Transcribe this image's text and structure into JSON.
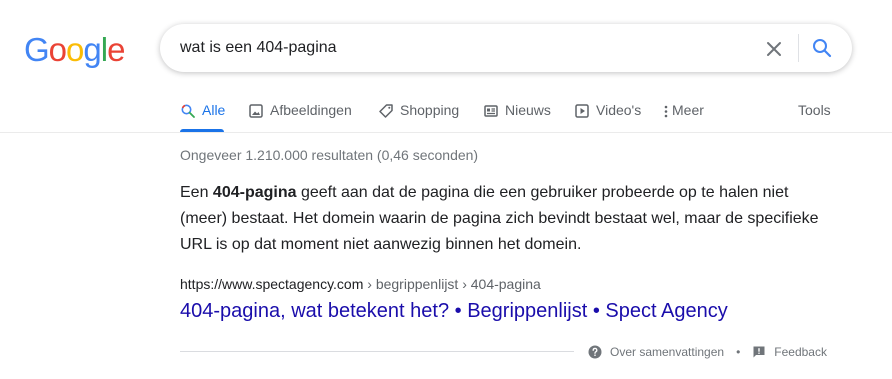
{
  "logo": {
    "letters": [
      "G",
      "o",
      "o",
      "g",
      "l",
      "e"
    ],
    "colors": [
      "#4285F4",
      "#EA4335",
      "#FBBC05",
      "#4285F4",
      "#34A853",
      "#EA4335"
    ]
  },
  "search": {
    "query": "wat is een 404-pagina",
    "clear_icon": "close-icon",
    "search_icon": "search-icon"
  },
  "tabs": [
    {
      "label": "Alle",
      "icon": "search-icon",
      "active": true
    },
    {
      "label": "Afbeeldingen",
      "icon": "image-icon"
    },
    {
      "label": "Shopping",
      "icon": "tag-icon"
    },
    {
      "label": "Nieuws",
      "icon": "news-icon"
    },
    {
      "label": "Video's",
      "icon": "play-icon"
    },
    {
      "label": "Meer",
      "icon": "more-vert-icon"
    }
  ],
  "tools_label": "Tools",
  "stats": "Ongeveer 1.210.000 resultaten (0,46 seconden)",
  "featured_snippet": {
    "pre": "Een ",
    "bold": "404-pagina",
    "post": " geeft aan dat de pagina die een gebruiker probeerde op te halen niet (meer) bestaat. Het domein waarin de pagina zich bevindt bestaat wel, maar de specifieke URL is op dat moment niet aanwezig binnen het domein."
  },
  "result": {
    "domain": "https://www.spectagency.com",
    "path": " › begrippenlijst › 404-pagina",
    "title": "404-pagina, wat betekent het? • Begrippenlijst • Spect Agency"
  },
  "footer": {
    "about_label": "Over samenvattingen",
    "separator": "•",
    "feedback_label": "Feedback"
  },
  "colors": {
    "accent": "#1a73e8",
    "link": "#1a0dab",
    "muted": "#70757a"
  }
}
